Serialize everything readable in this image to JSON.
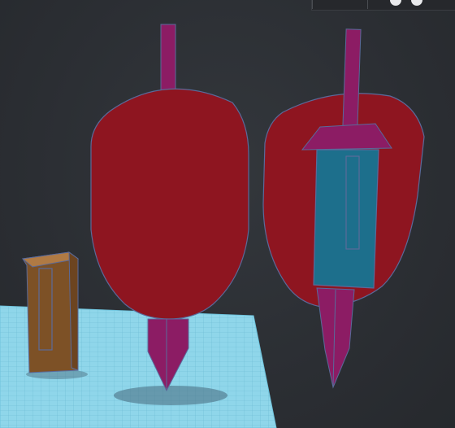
{
  "toolbar_fragment": {
    "glyph": "ٴ"
  },
  "scene": {
    "description_objects": [
      "sword-shield-front",
      "sword-shield-with-sheath",
      "wooden-block"
    ],
    "colors": {
      "background": "#2d3035",
      "workplane": "#8fd6ea",
      "workplane_grid": "#6cb9d2",
      "shield_red": "#8e1520",
      "blade_magenta": "#8c1c64",
      "sheath_teal": "#1d6f8c",
      "block_brown": "#8a5a2a",
      "outline": "#5a6a9a"
    }
  }
}
